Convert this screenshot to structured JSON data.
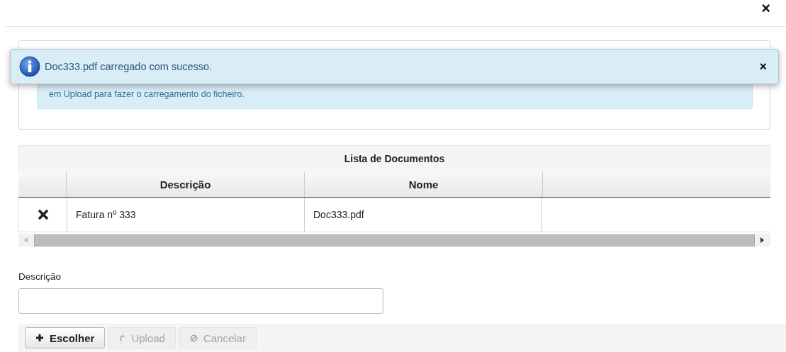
{
  "dialog": {
    "close": "×"
  },
  "toast": {
    "message": "Doc333.pdf carregado com sucesso.",
    "close": "×"
  },
  "info_alert": {
    "text": "em Upload para fazer o carregamento do ficheiro."
  },
  "table": {
    "title": "Lista de Documentos",
    "columns": [
      "Descrição",
      "Nome"
    ],
    "rows": [
      {
        "descricao": "Fatura nº 333",
        "nome": "Doc333.pdf"
      }
    ]
  },
  "form": {
    "label": "Descrição"
  },
  "buttons": [
    {
      "kind": "add",
      "label": "Escolher",
      "disabled": false
    },
    {
      "kind": "upload",
      "label": "Upload",
      "disabled": true
    },
    {
      "kind": "cancel",
      "label": "Cancelar",
      "disabled": true
    }
  ]
}
